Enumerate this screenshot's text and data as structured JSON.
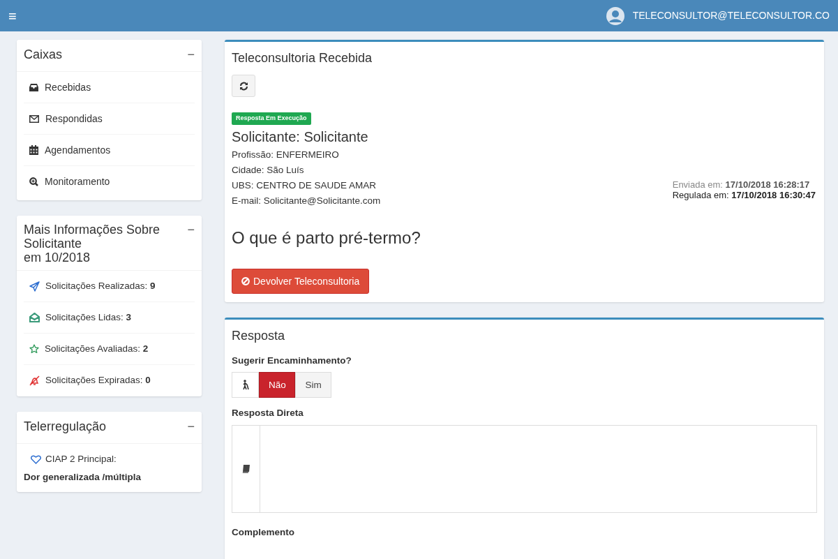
{
  "top_bar": {
    "menu_icon": "≡",
    "user_email": "TELECONSULTOR@TELECONSULTOR.CO"
  },
  "sidebar": {
    "boxes": {
      "title": "Caixas",
      "collapse": "−",
      "items": [
        {
          "label": "Recebidas"
        },
        {
          "label": "Respondidas"
        },
        {
          "label": "Agendamentos"
        },
        {
          "label": "Monitoramento"
        }
      ]
    },
    "info": {
      "title_lines": [
        "Mais Informações Sobre",
        "Solicitante",
        "em 10/2018"
      ],
      "collapse": "−",
      "items": [
        {
          "text": "Solicitações Realizadas: **9**",
          "color": "#2f6fd0"
        },
        {
          "text": "Solicitações Lidas: **3**",
          "color": "#3a9a7a"
        },
        {
          "text": "Solicitações Avaliadas: **2**",
          "color": "#2f9a5a"
        },
        {
          "text": "Solicitações Expiradas: **0**",
          "color": "#e03030"
        }
      ]
    },
    "regulation": {
      "title": "Telerregulação",
      "collapse": "−",
      "label": "CIAP 2 Principal:",
      "value": "Dor generalizada /múltipla"
    }
  },
  "consult": {
    "title": "Teleconsultoria Recebida",
    "status_badge": "Resposta Em Execução",
    "requester": "Solicitante: Solicitante",
    "details": [
      "Profissão: ENFERMEIRO",
      "Cidade: São Luís",
      "UBS: CENTRO DE SAUDE AMAR",
      "E-mail: Solicitante@Solicitante.com"
    ],
    "sent": "Enviada em: **17/10/2018 16:28:17**",
    "regulated": "Regulada em: **17/10/2018 16:30:47**",
    "question": "O que é parto pré-termo?",
    "return_button": "Devolver Teleconsultoria"
  },
  "response": {
    "title": "Resposta",
    "referral_label": "Sugerir Encaminhamento?",
    "referral_options": [
      {
        "label": "Não",
        "selected": true
      },
      {
        "label": "Sim",
        "selected": false
      }
    ],
    "direct_label": "Resposta Direta",
    "complement_label": "Complemento"
  }
}
